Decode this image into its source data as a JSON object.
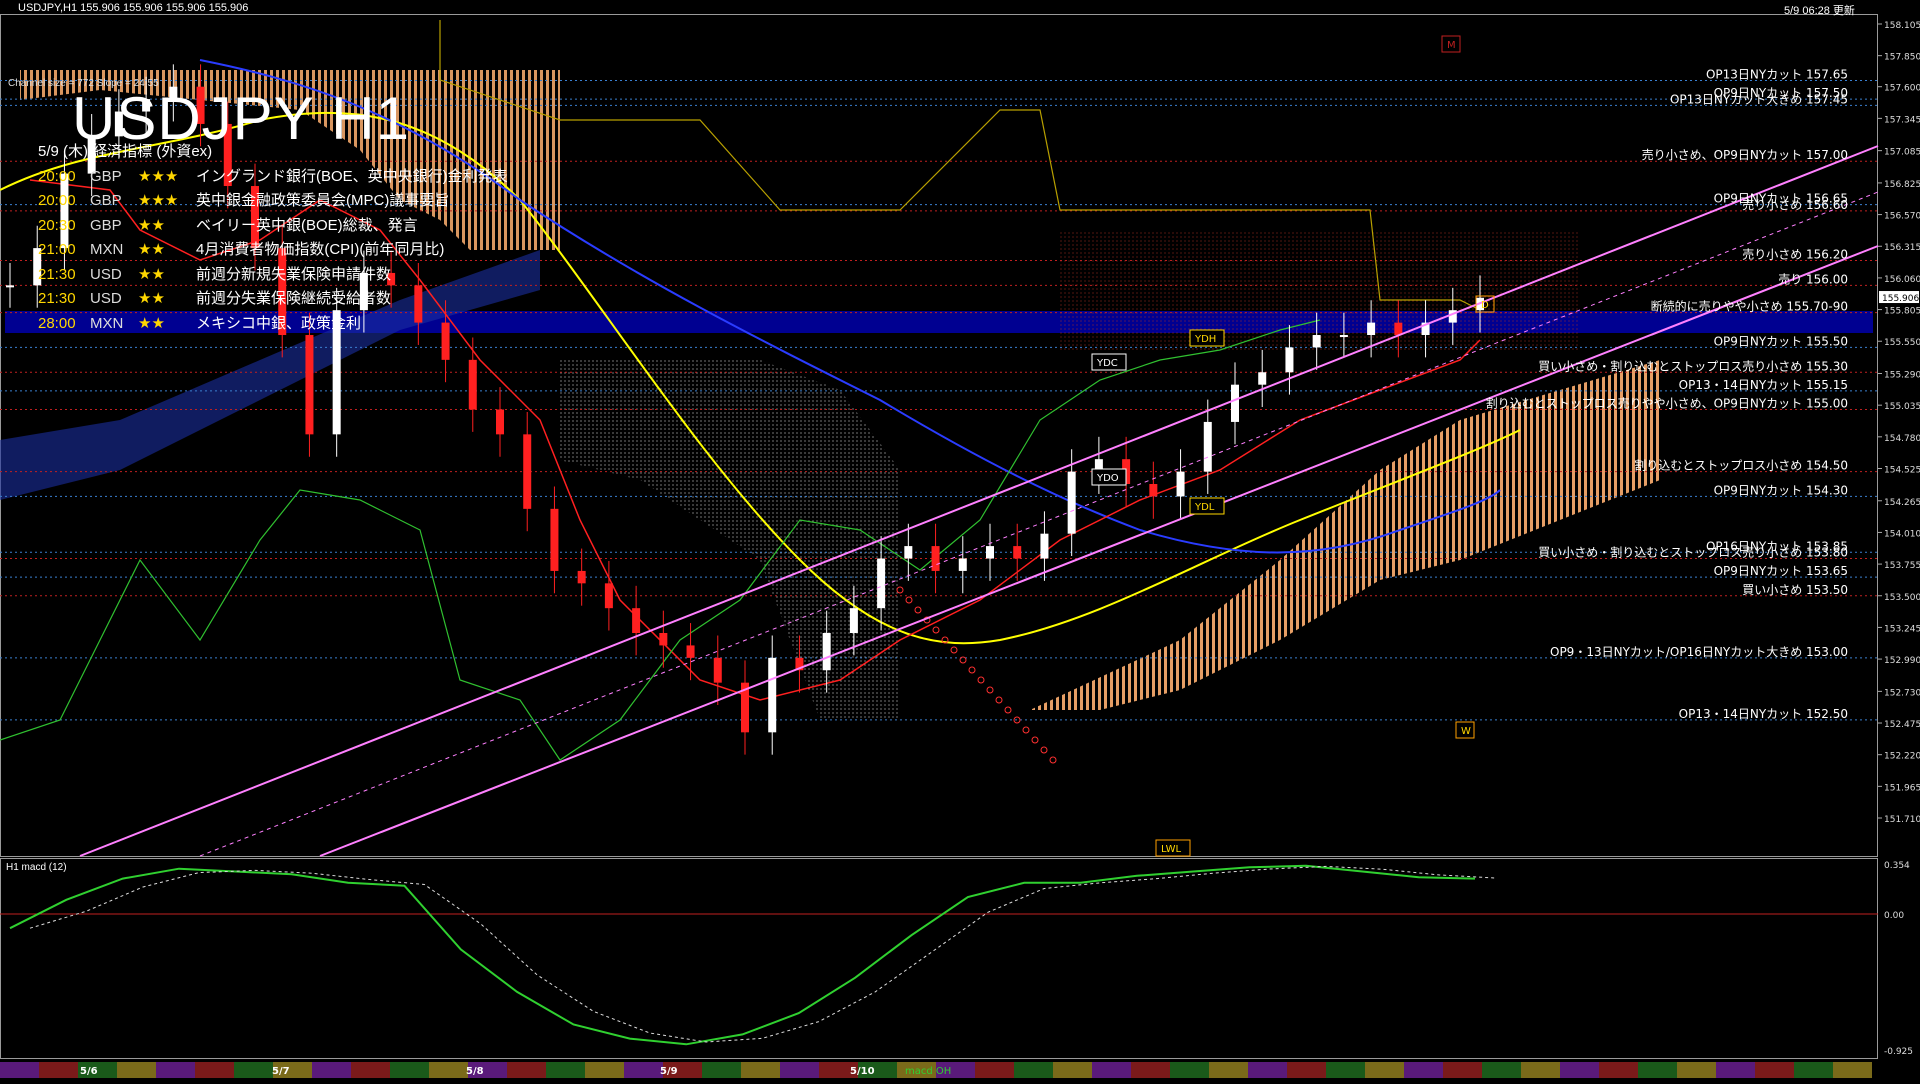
{
  "header": {
    "symbol_info": "USDJPY,H1  155.906 155.906 155.906 155.906",
    "updated": "5/9 06:28 更新"
  },
  "title": "USDJPY H1",
  "channel_info": "Channel size = 772 Slope = 24.55",
  "events": {
    "heading": "5/9 (木) 経済指標 (外資ex)",
    "items": [
      {
        "time": "20:00",
        "currency": "GBP",
        "stars": "★★★",
        "name": "イングランド銀行(BOE、英中央銀行)金利発表"
      },
      {
        "time": "20:00",
        "currency": "GBP",
        "stars": "★★★",
        "name": "英中銀金融政策委員会(MPC)議事要旨"
      },
      {
        "time": "20:30",
        "currency": "GBP",
        "stars": "★★",
        "name": "ベイリー英中銀(BOE)総裁、発言"
      },
      {
        "time": "21:00",
        "currency": "MXN",
        "stars": "★★",
        "name": "4月消費者物価指数(CPI)(前年同月比)"
      },
      {
        "time": "21:30",
        "currency": "USD",
        "stars": "★★",
        "name": "前週分新規失業保険申請件数"
      },
      {
        "time": "21:30",
        "currency": "USD",
        "stars": "★★",
        "name": "前週分失業保険継続受給者数"
      },
      {
        "time": "28:00",
        "currency": "MXN",
        "stars": "★★",
        "name": "メキシコ中銀、政策金利"
      }
    ]
  },
  "price_scale": [
    "158.105",
    "157.850",
    "157.600",
    "157.345",
    "157.085",
    "156.825",
    "156.570",
    "156.315",
    "156.060",
    "155.805",
    "155.550",
    "155.290",
    "155.035",
    "154.780",
    "154.525",
    "154.265",
    "154.010",
    "153.755",
    "153.500",
    "153.245",
    "152.990",
    "152.730",
    "152.475",
    "152.220",
    "151.965",
    "151.710"
  ],
  "current_price": "155.906",
  "macd_scale": [
    "0.354",
    "0.00",
    "-0.925"
  ],
  "macd_label": "H1  macd (12)",
  "time_labels": [
    "5/6",
    "5/7",
    "5/8",
    "5/9",
    "5/10"
  ],
  "bottom_tag": "macd OH",
  "order_levels": [
    {
      "label": "OP13日NYカット 157.65",
      "price": 157.65
    },
    {
      "label": "OP9日NYカット 157.50",
      "price": 157.5
    },
    {
      "label": "OP13日NYカット大きめ 157.45",
      "price": 157.45
    },
    {
      "label": "売り小さめ、OP9日NYカット 157.00",
      "price": 157.0
    },
    {
      "label": "OP9日NYカット 156.65",
      "price": 156.65
    },
    {
      "label": "売り小さめ 156.60",
      "price": 156.6
    },
    {
      "label": "売り小さめ 156.20",
      "price": 156.2
    },
    {
      "label": "売り 156.00",
      "price": 156.0
    },
    {
      "label": "断続的に売りやや小さめ 155.70-90",
      "price": 155.78
    },
    {
      "label": "OP9日NYカット 155.50",
      "price": 155.5
    },
    {
      "label": "買い小さめ・割り込むとストップロス売り小さめ 155.30",
      "price": 155.3
    },
    {
      "label": "OP13・14日NYカット 155.15",
      "price": 155.15
    },
    {
      "label": "割り込むとストップロス売りやや小さめ、OP9日NYカット 155.00",
      "price": 155.0
    },
    {
      "label": "割り込むとストップロス小さめ 154.50",
      "price": 154.5
    },
    {
      "label": "OP9日NYカット 154.30",
      "price": 154.3
    },
    {
      "label": "OP16日NYカット 153.85",
      "price": 153.85
    },
    {
      "label": "買い小さめ・割り込むとストップロス売り小さめ 153.80",
      "price": 153.8
    },
    {
      "label": "OP9日NYカット 153.65",
      "price": 153.65
    },
    {
      "label": "買い小さめ 153.50",
      "price": 153.5
    },
    {
      "label": "OP9・13日NYカット/OP16日NYカット大きめ 153.00",
      "price": 153.0
    },
    {
      "label": "OP13・14日NYカット 152.50",
      "price": 152.5
    }
  ],
  "markers": [
    {
      "text": "YDH"
    },
    {
      "text": "YDC"
    },
    {
      "text": "YDO"
    },
    {
      "text": "YDL"
    },
    {
      "text": "W"
    },
    {
      "text": "D"
    },
    {
      "text": "M"
    },
    {
      "text": "LWL"
    }
  ],
  "chart_data": {
    "type": "line",
    "title": "USDJPY H1",
    "ylim": [
      151.71,
      158.2
    ],
    "x_labels": [
      "5/6",
      "5/7",
      "5/8",
      "5/9",
      "5/10"
    ],
    "series": [
      {
        "values": [
          156.0,
          156.3,
          156.9,
          157.2,
          157.4,
          157.5,
          157.6,
          157.3,
          156.8,
          156.3,
          155.6,
          154.8,
          155.8,
          156.1,
          156.0,
          155.7,
          155.4,
          155.0,
          154.8,
          154.2,
          153.7,
          153.6,
          153.4,
          153.2,
          153.1,
          153.0,
          152.8,
          152.4,
          153.0,
          152.9,
          153.2,
          153.4,
          153.8,
          153.9,
          153.7,
          153.8,
          153.9,
          153.8,
          154.0,
          154.5,
          154.6,
          154.4,
          154.3,
          154.5,
          154.9,
          155.2,
          155.3,
          155.5,
          155.6,
          155.6,
          155.7,
          155.6,
          155.7,
          155.8,
          155.9
        ]
      },
      {
        "name": "macd (12)",
        "values": [
          -0.1,
          0.1,
          0.25,
          0.32,
          0.3,
          0.28,
          0.22,
          0.2,
          -0.25,
          -0.55,
          -0.78,
          -0.88,
          -0.92,
          -0.85,
          -0.7,
          -0.45,
          -0.15,
          0.12,
          0.22,
          0.22,
          0.27,
          0.3,
          0.33,
          0.34,
          0.3,
          0.26,
          0.25
        ]
      }
    ]
  },
  "colors": {
    "background": "#000000",
    "candle_up": "#ffffff",
    "candle_down": "#ff2020",
    "channel": "#ff80ff",
    "kumo": "#ffb070",
    "ma_yellow": "#ffff00",
    "ma_blue": "#2020ff",
    "zone_blue": "#000099"
  }
}
